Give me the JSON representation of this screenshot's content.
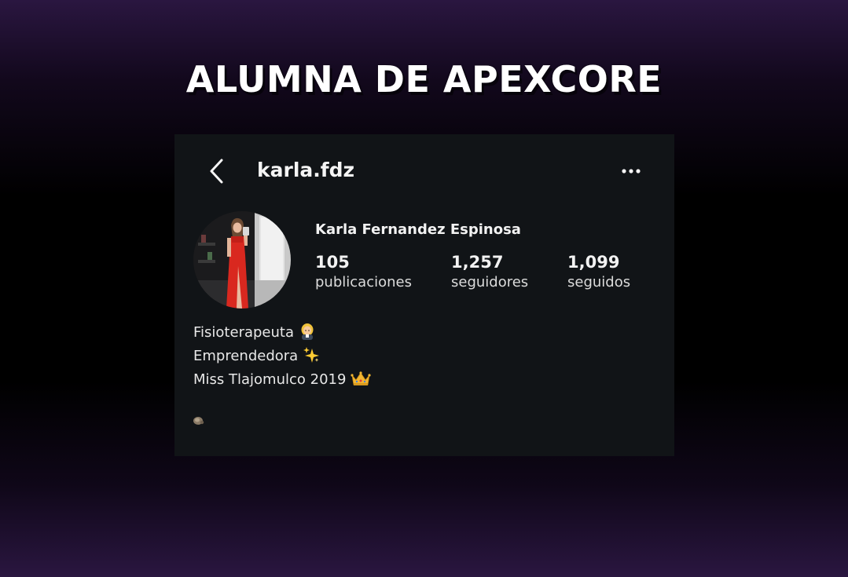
{
  "headline": "ALUMNA DE APEXCORE",
  "profile": {
    "username": "karla.fdz",
    "full_name": "Karla Fernandez Espinosa",
    "stats": [
      {
        "value": "105",
        "label": "publicaciones"
      },
      {
        "value": "1,257",
        "label": "seguidores"
      },
      {
        "value": "1,099",
        "label": "seguidos"
      }
    ],
    "bio": [
      {
        "text": "Fisioterapeuta",
        "emoji": "woman-health-worker-icon"
      },
      {
        "text": "Emprendedora",
        "emoji": "sparkles-icon"
      },
      {
        "text": "Miss Tlajomulco 2019",
        "emoji": "crown-icon"
      }
    ]
  },
  "icons": {
    "back": "chevron-left-icon",
    "more": "more-options-icon",
    "link": "small-link-icon"
  },
  "colors": {
    "card_bg": "#111417",
    "text_primary": "#f5f5f5",
    "gradient_purple": "#2a1640"
  }
}
